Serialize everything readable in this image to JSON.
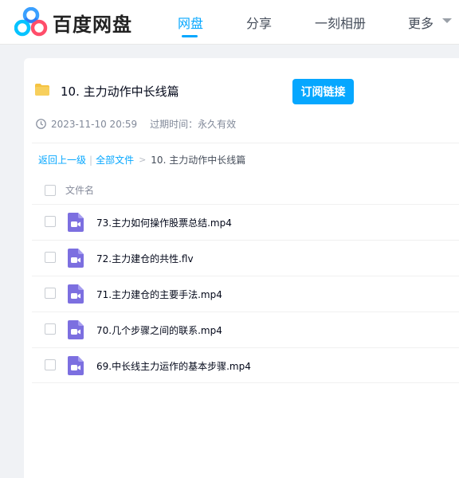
{
  "header": {
    "logo_text": "百度网盘",
    "nav": [
      {
        "label": "网盘",
        "active": true
      },
      {
        "label": "分享",
        "active": false
      },
      {
        "label": "一刻相册",
        "active": false
      },
      {
        "label": "更多",
        "active": false
      }
    ]
  },
  "share": {
    "title": "10. 主力动作中长线篇",
    "subscribe_label": "订阅链接",
    "created_at": "2023-11-10 20:59",
    "expire_label": "过期时间：",
    "expire_value": "永久有效"
  },
  "breadcrumb": {
    "back": "返回上一级",
    "separator": "|",
    "all_files": "全部文件",
    "arrow": ">",
    "current": "10. 主力动作中长线篇"
  },
  "list": {
    "column_header": "文件名",
    "files": [
      {
        "name": "73.主力如何操作股票总结.mp4",
        "icon": "video-file-icon"
      },
      {
        "name": "72.主力建仓的共性.flv",
        "icon": "video-file-icon"
      },
      {
        "name": "71.主力建仓的主要手法.mp4",
        "icon": "video-file-icon"
      },
      {
        "name": "70.几个步骤之间的联系.mp4",
        "icon": "video-file-icon"
      },
      {
        "name": "69.中长线主力运作的基本步骤.mp4",
        "icon": "video-file-icon"
      }
    ]
  },
  "colors": {
    "accent": "#06a7ff",
    "video_icon": "#7c6fe0",
    "folder": "#f5c342"
  }
}
